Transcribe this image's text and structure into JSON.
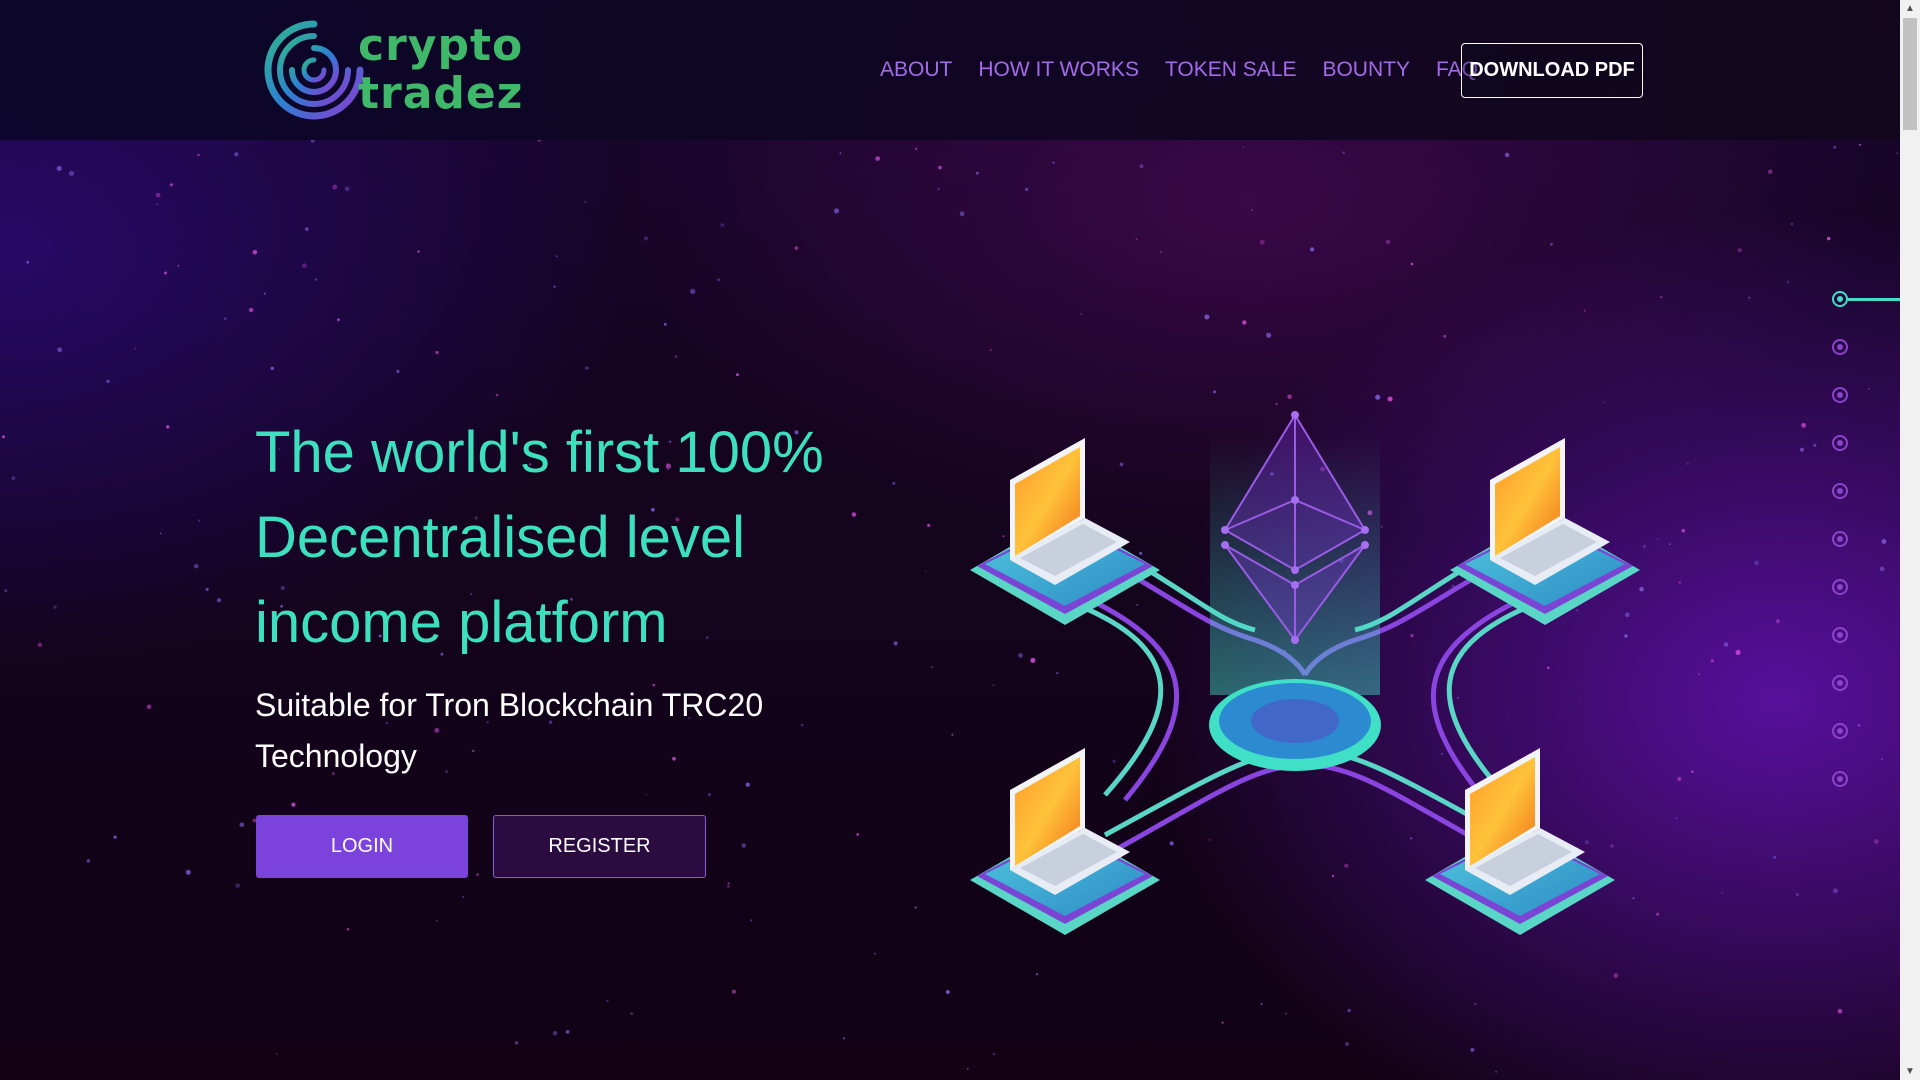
{
  "brand": {
    "name_line1": "crypto",
    "name_line2": "tradez",
    "logo_icon": "spiral-logo-icon",
    "color": "#3fb86a"
  },
  "nav": {
    "links": [
      "ABOUT",
      "HOW IT WORKS",
      "TOKEN SALE",
      "BOUNTY",
      "FAQ"
    ],
    "download_label": "DOWNLOAD PDF"
  },
  "hero": {
    "title": "The world's first 100% Decentralised level income platform",
    "subtitle": "Suitable for Tron Blockchain TRC20 Technology",
    "login_label": "LOGIN",
    "register_label": "REGISTER",
    "illustration_icon": "blockchain-network-illustration"
  },
  "side_nav": {
    "count": 11,
    "active_index": 0
  },
  "colors": {
    "accent_teal": "#3ce0bf",
    "accent_purple": "#7b43db",
    "nav_link": "#a36be8"
  }
}
